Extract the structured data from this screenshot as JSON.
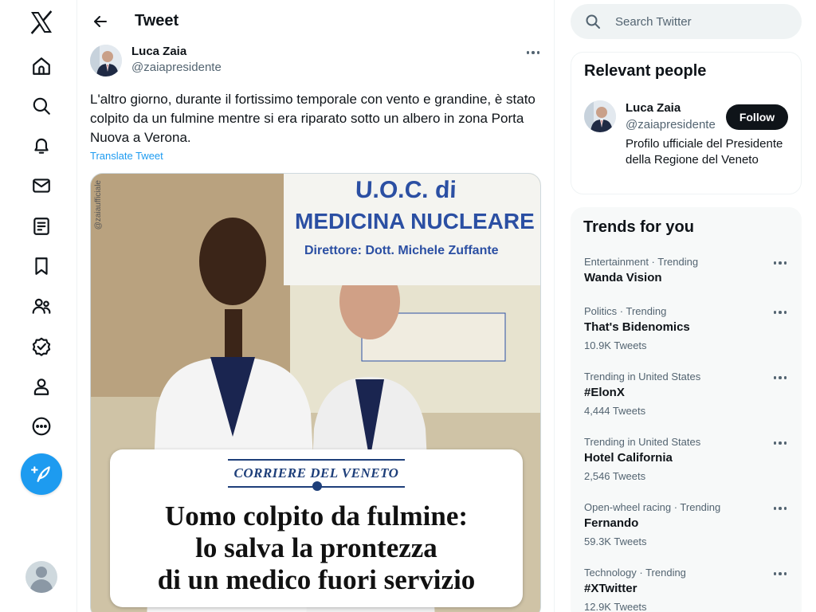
{
  "nav": {
    "items": [
      {
        "icon": "home-icon",
        "label": "Home"
      },
      {
        "icon": "explore-icon",
        "label": "Explore"
      },
      {
        "icon": "notifications-icon",
        "label": "Notifications"
      },
      {
        "icon": "messages-icon",
        "label": "Messages"
      },
      {
        "icon": "lists-icon",
        "label": "Lists"
      },
      {
        "icon": "bookmarks-icon",
        "label": "Bookmarks"
      },
      {
        "icon": "communities-icon",
        "label": "Communities"
      },
      {
        "icon": "verified-icon",
        "label": "Verified"
      },
      {
        "icon": "profile-icon",
        "label": "Profile"
      },
      {
        "icon": "more-icon",
        "label": "More"
      }
    ]
  },
  "header": {
    "title": "Tweet"
  },
  "tweet": {
    "author_name": "Luca Zaia",
    "author_handle": "@zaiapresidente",
    "text": "L'altro giorno, durante il fortissimo temporale con vento e grandine, è stato colpito da un fulmine mentre si era riparato sotto un albero in zona Porta Nuova a Verona.",
    "translate_label": "Translate Tweet",
    "media": {
      "watermark": "@zaiaufficiale",
      "sign_line1": "U.O.C. di",
      "sign_line2": "MEDICINA NUCLEARE",
      "sign_line3": "Direttore: Dott. Michele Zuffante",
      "masthead": "CORRIERE DEL VENETO",
      "headline_line1": "Uomo colpito da fulmine:",
      "headline_line2": "lo salva la prontezza",
      "headline_line3": "di un medico fuori servizio"
    }
  },
  "search": {
    "placeholder": "Search Twitter"
  },
  "relevant": {
    "title": "Relevant people",
    "name": "Luca Zaia",
    "handle": "@zaiapresidente",
    "follow_label": "Follow",
    "bio": "Profilo ufficiale del Presidente della Regione del Veneto"
  },
  "trends": {
    "title": "Trends for you",
    "items": [
      {
        "meta": "Entertainment · Trending",
        "name": "Wanda Vision",
        "count": ""
      },
      {
        "meta": "Politics · Trending",
        "name": "That's Bidenomics",
        "count": "10.9K Tweets"
      },
      {
        "meta": "Trending in United States",
        "name": "#ElonX",
        "count": "4,444 Tweets"
      },
      {
        "meta": "Trending in United States",
        "name": "Hotel California",
        "count": "2,546 Tweets"
      },
      {
        "meta": "Open-wheel racing · Trending",
        "name": "Fernando",
        "count": "59.3K Tweets"
      },
      {
        "meta": "Technology · Trending",
        "name": "#XTwitter",
        "count": "12.9K Tweets"
      }
    ]
  },
  "colors": {
    "accent": "#1d9bf0",
    "text": "#0f1419",
    "secondary": "#536471"
  }
}
